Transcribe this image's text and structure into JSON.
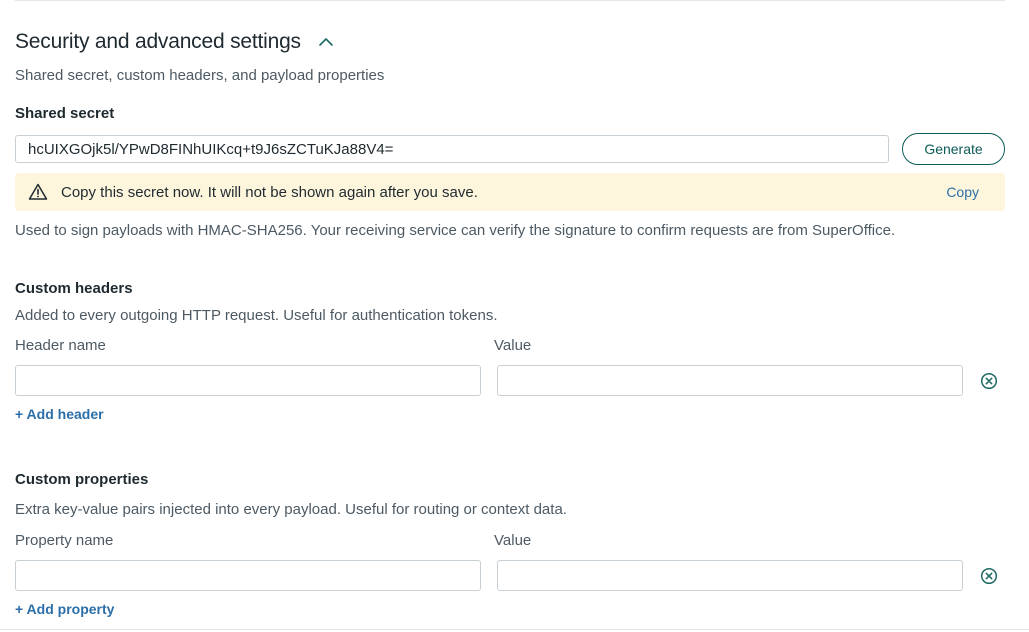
{
  "section": {
    "title": "Security and advanced settings",
    "subtitle": "Shared secret, custom headers, and payload properties"
  },
  "secret": {
    "label": "Shared secret",
    "value": "hcUIXGOjk5l/YPwD8FINhUIKcq+t9J6sZCTuKJa88V4=",
    "generate_label": "Generate",
    "warning_text": "Copy this secret now. It will not be shown again after you save.",
    "copy_label": "Copy",
    "help": "Used to sign payloads with HMAC-SHA256. Your receiving service can verify the signature to confirm requests are from SuperOffice."
  },
  "headers": {
    "title": "Custom headers",
    "help": "Added to every outgoing HTTP request. Useful for authentication tokens.",
    "name_label": "Header name",
    "value_label": "Value",
    "name_value": "",
    "value_value": "",
    "add_label": "+ Add header"
  },
  "properties": {
    "title": "Custom properties",
    "help": "Extra key-value pairs injected into every payload. Useful for routing or context data.",
    "name_label": "Property name",
    "value_label": "Value",
    "name_value": "",
    "value_value": "",
    "add_label": "+ Add property"
  },
  "colors": {
    "accent": "#0d5b57",
    "link": "#2c6fa8",
    "warning_bg": "#fdf6dc"
  },
  "icons": {
    "collapse": "chevron-up-icon",
    "warning": "warning-triangle-icon",
    "remove": "close-circle-icon"
  }
}
